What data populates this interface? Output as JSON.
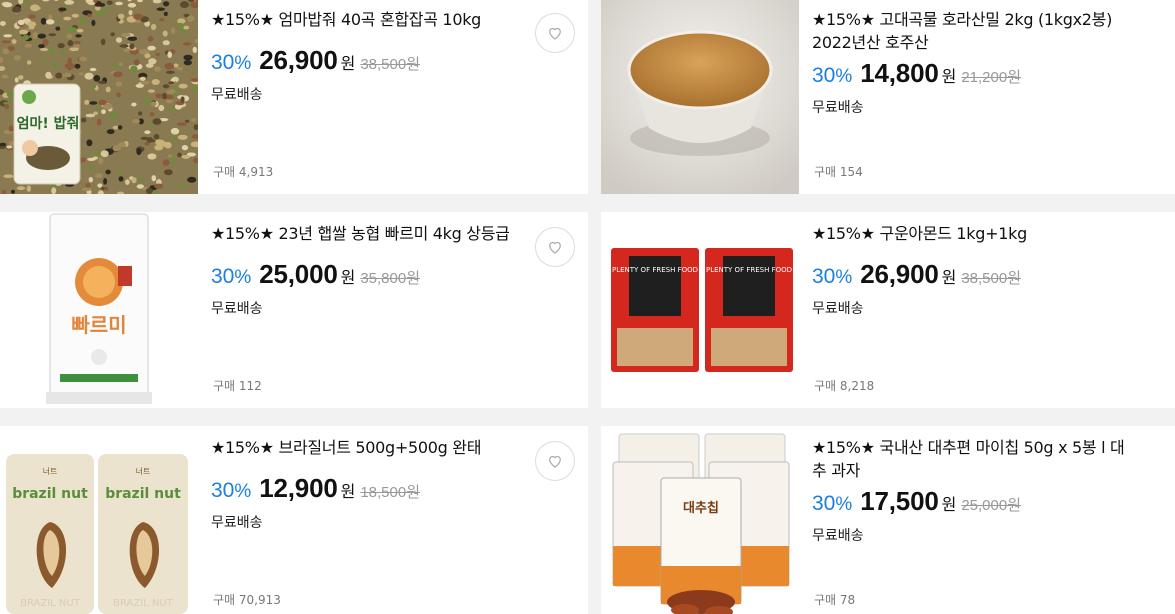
{
  "products": [
    {
      "title": "★15%★ 엄마밥줘 40곡 혼합잡곡 10kg",
      "discount_num": "30",
      "discount_pct": "%",
      "price": "26,900",
      "won": "원",
      "original_price": "38,500원",
      "shipping": "무료배송",
      "sold": "구매 4,913",
      "icon": "heart-icon"
    },
    {
      "title": "★15%★ 고대곡물 호라산밀 2kg (1kgx2봉) 2022년산 호주산",
      "discount_num": "30",
      "discount_pct": "%",
      "price": "14,800",
      "won": "원",
      "original_price": "21,200원",
      "shipping": "무료배송",
      "sold": "구매 154",
      "icon": "heart-icon"
    },
    {
      "title": "★15%★ 23년 햅쌀 농협 빠르미 4kg 상등급",
      "discount_num": "30",
      "discount_pct": "%",
      "price": "25,000",
      "won": "원",
      "original_price": "35,800원",
      "shipping": "무료배송",
      "sold": "구매 112",
      "icon": "heart-icon"
    },
    {
      "title": "★15%★ 구운아몬드 1kg+1kg",
      "discount_num": "30",
      "discount_pct": "%",
      "price": "26,900",
      "won": "원",
      "original_price": "38,500원",
      "shipping": "무료배송",
      "sold": "구매 8,218",
      "icon": "heart-icon"
    },
    {
      "title": "★15%★ 브라질너트 500g+500g 완태",
      "discount_num": "30",
      "discount_pct": "%",
      "price": "12,900",
      "won": "원",
      "original_price": "18,500원",
      "shipping": "무료배송",
      "sold": "구매 70,913",
      "icon": "heart-icon"
    },
    {
      "title": "★15%★ 국내산 대추편 마이칩 50g x 5봉 l 대추 과자",
      "discount_num": "30",
      "discount_pct": "%",
      "price": "17,500",
      "won": "원",
      "original_price": "25,000원",
      "shipping": "무료배송",
      "sold": "구매 78",
      "icon": "heart-icon"
    }
  ],
  "images": {
    "rice_bag_text": "빠르미",
    "almond_bag_text": "PLENTY OF FRESH FOOD",
    "brazil_bag_text": "brazil nut",
    "brazil_bag_small": "너트",
    "brazil_bag_side": "BRAZIL NUT",
    "mixgrain_bag_text": "엄마! 밥줘",
    "jujube_bag_text": "대추칩"
  },
  "colors": {
    "accent_blue": "#1a7fe0",
    "strike_gray": "#999999",
    "almond_bag_red": "#d4271e"
  }
}
